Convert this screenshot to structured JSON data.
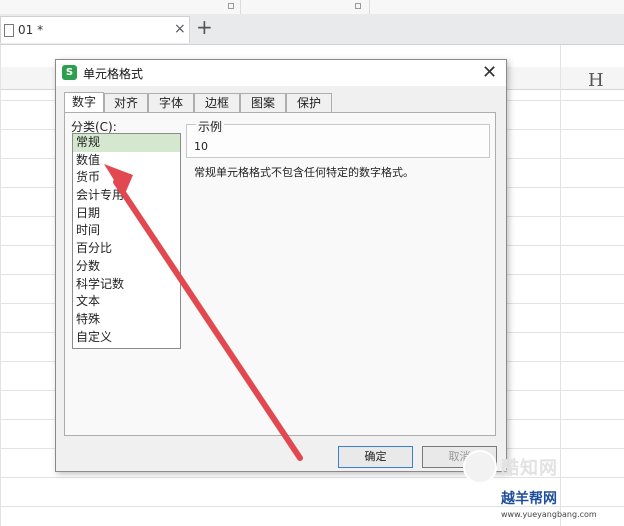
{
  "document": {
    "tab_title": "01 *",
    "new_tab_symbol": "+",
    "close_symbol": "×"
  },
  "sheet": {
    "visible_column_header": "H"
  },
  "dialog": {
    "title": "单元格格式",
    "app_icon_letter": "S",
    "close_symbol": "✕",
    "tabs": [
      "数字",
      "对齐",
      "字体",
      "边框",
      "图案",
      "保护"
    ],
    "active_tab": "数字",
    "category_label": "分类(C):",
    "categories": [
      "常规",
      "数值",
      "货币",
      "会计专用",
      "日期",
      "时间",
      "百分比",
      "分数",
      "科学记数",
      "文本",
      "特殊",
      "自定义"
    ],
    "selected_category": "常规",
    "sample_label": "示例",
    "sample_value": "10",
    "description": "常规单元格格式不包含任何特定的数字格式。",
    "ok_label": "确定",
    "cancel_label": "取消"
  },
  "watermark": {
    "line1": "酷知网",
    "line2": "越羊帮网",
    "url": "www.yueyangbang.com"
  },
  "colors": {
    "annotation_arrow": "#e2484f",
    "selection": "#d4e8cf",
    "app_icon": "#2e9e4f"
  }
}
